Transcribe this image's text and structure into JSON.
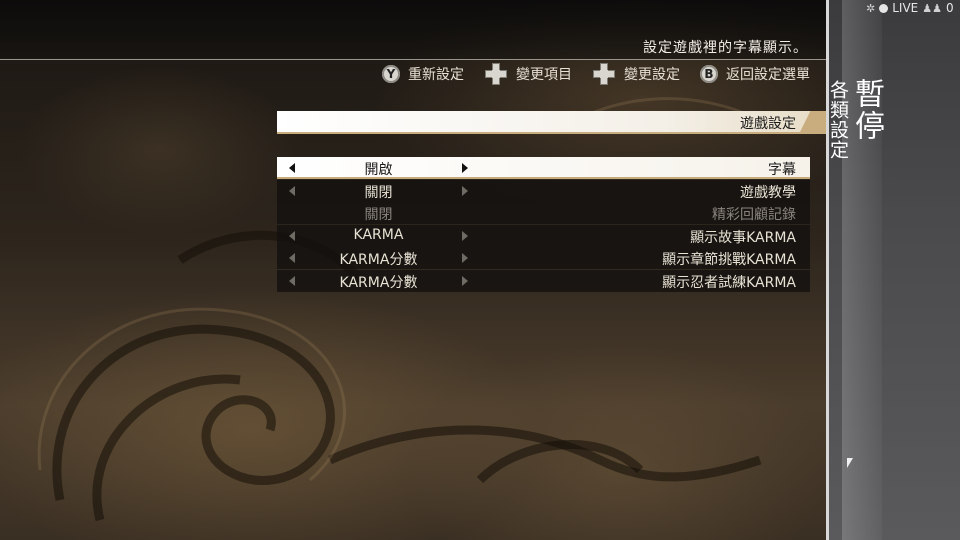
{
  "description": "設定遊戲裡的字幕顯示。",
  "controls": [
    {
      "button": "Y",
      "icon": "y-button-icon",
      "label": "重新設定"
    },
    {
      "button": "dpad",
      "icon": "dpad-icon",
      "label": "變更項目"
    },
    {
      "button": "dpad",
      "icon": "dpad-icon",
      "label": "變更設定"
    },
    {
      "button": "B",
      "icon": "b-button-icon",
      "label": "返回設定選單"
    }
  ],
  "section_title": "遊戲設定",
  "options": [
    {
      "label": "字幕",
      "value": "開啟",
      "selected": true,
      "enabled": true
    },
    {
      "label": "遊戲教學",
      "value": "關閉",
      "selected": false,
      "enabled": true
    },
    {
      "label": "精彩回顧記錄",
      "value": "關閉",
      "selected": false,
      "enabled": false
    },
    {
      "label": "顯示故事KARMA",
      "value": "KARMA",
      "selected": false,
      "enabled": true
    },
    {
      "label": "顯示章節挑戰KARMA",
      "value": "KARMA分數",
      "selected": false,
      "enabled": true
    },
    {
      "label": "顯示忍者試練KARMA",
      "value": "KARMA分數",
      "selected": false,
      "enabled": true
    }
  ],
  "side_panel": {
    "title": "暫停",
    "subtitle": "各類設定"
  },
  "status": {
    "live_label": "LIVE",
    "viewer_count": "0"
  },
  "colors": {
    "accent": "#c8ae7e",
    "selected_bg": "#ffffff",
    "side_panel": "#4a4a4c"
  }
}
